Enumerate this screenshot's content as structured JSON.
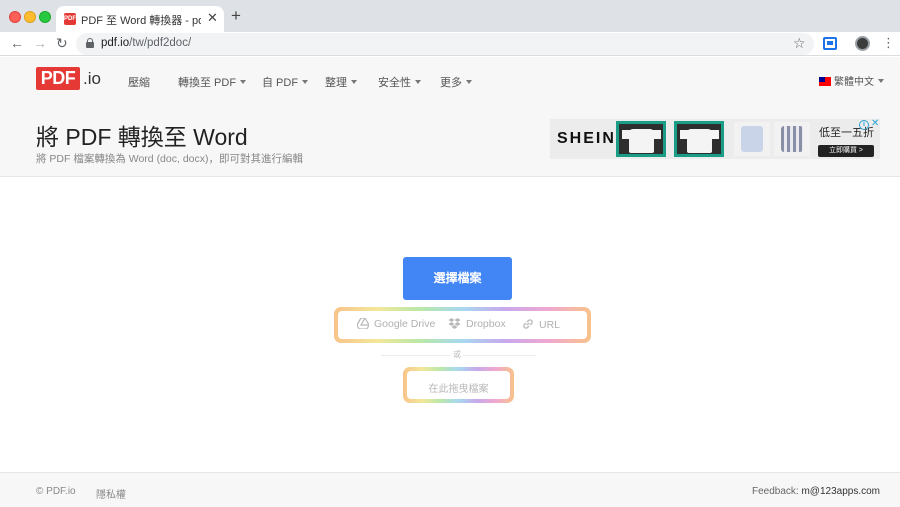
{
  "browser": {
    "tab_title": "PDF 至 Word 轉換器 - pdf 至 doc",
    "favicon_label": "PDF",
    "close_glyph": "✕",
    "new_tab_glyph": "+",
    "back_glyph": "←",
    "forward_glyph": "→",
    "reload_glyph": "↻",
    "url_host": "pdf.io",
    "url_path": "/tw/pdf2doc/",
    "star_glyph": "☆",
    "menu_glyph": "⋮"
  },
  "site": {
    "logo_pdf": "PDF",
    "logo_io": ".io",
    "nav": {
      "compress": "壓縮",
      "convert_to_pdf": "轉換至 PDF",
      "from_pdf": "自 PDF",
      "organize": "整理",
      "security": "安全性",
      "more": "更多"
    },
    "language": "繁體中文"
  },
  "hero": {
    "title": "將 PDF 轉換至 Word",
    "subtitle": "將 PDF 檔案轉換為 Word (doc, docx)，即可對其進行編輯"
  },
  "ad": {
    "brand": "SHEIN",
    "price_text": "低至一五折",
    "cta": "立即購買 >",
    "info_glyph": "i",
    "close_glyph": "✕",
    "colors": {
      "frame": "#1a9c86",
      "shirt_plaid": "#8a8fa8",
      "shirt_blue": "#c9d4e8"
    }
  },
  "upload": {
    "choose_button": "選擇檔案",
    "google_drive": "Google Drive",
    "dropbox": "Dropbox",
    "url": "URL",
    "or": "或",
    "drop_here": "在此拖曳檔案"
  },
  "footer": {
    "copyright": "© PDF.io",
    "privacy": "隱私權",
    "feedback_label": "Feedback: ",
    "feedback_email": "m@123apps.com"
  },
  "colors": {
    "brand_red": "#e53935",
    "primary_button": "#4285f4"
  }
}
